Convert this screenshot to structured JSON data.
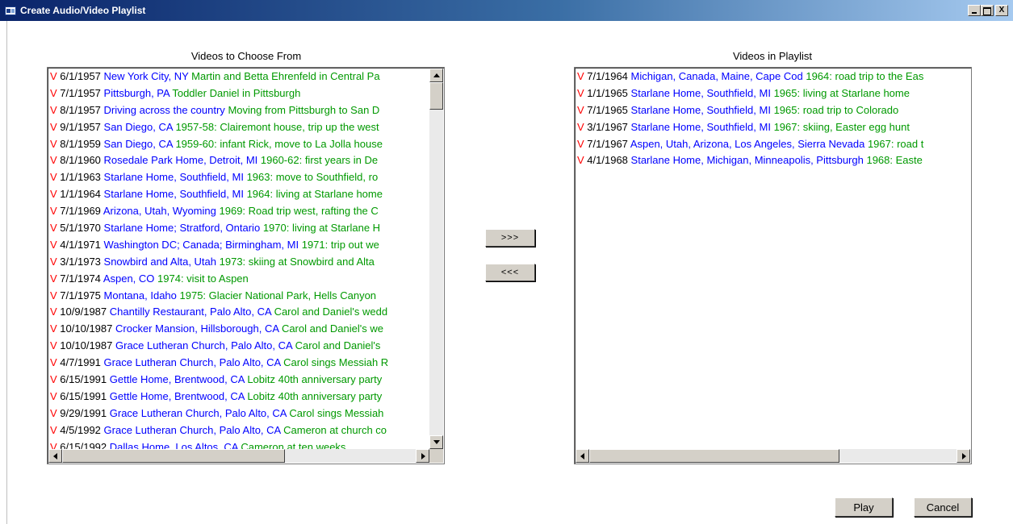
{
  "window": {
    "title": "Create Audio/Video Playlist",
    "buttons": {
      "minimize": "_",
      "maximize": "□",
      "close": "X"
    }
  },
  "available": {
    "label": "Videos to Choose From",
    "items": [
      {
        "type": "V",
        "date": "6/1/1957",
        "place": "New York City, NY",
        "desc": "Martin and Betta Ehrenfeld in Central Pa"
      },
      {
        "type": "V",
        "date": "7/1/1957",
        "place": "Pittsburgh, PA",
        "desc": "Toddler Daniel in Pittsburgh"
      },
      {
        "type": "V",
        "date": "8/1/1957",
        "place": "Driving across the country",
        "desc": "Moving from Pittsburgh to San D"
      },
      {
        "type": "V",
        "date": "9/1/1957",
        "place": "San Diego, CA",
        "desc": "1957-58: Clairemont house, trip up the west"
      },
      {
        "type": "V",
        "date": "8/1/1959",
        "place": "San Diego, CA",
        "desc": "1959-60: infant Rick, move to La Jolla house"
      },
      {
        "type": "V",
        "date": "8/1/1960",
        "place": "Rosedale Park Home, Detroit, MI",
        "desc": "1960-62: first years in De"
      },
      {
        "type": "V",
        "date": "1/1/1963",
        "place": "Starlane Home, Southfield, MI",
        "desc": "1963: move to Southfield, ro"
      },
      {
        "type": "V",
        "date": "1/1/1964",
        "place": "Starlane Home, Southfield, MI",
        "desc": "1964: living at Starlane home"
      },
      {
        "type": "V",
        "date": "7/1/1969",
        "place": "Arizona, Utah, Wyoming",
        "desc": "1969: Road trip west, rafting the C"
      },
      {
        "type": "V",
        "date": "5/1/1970",
        "place": "Starlane Home; Stratford, Ontario",
        "desc": "1970: living at Starlane H"
      },
      {
        "type": "V",
        "date": "4/1/1971",
        "place": "Washington DC; Canada; Birmingham, MI",
        "desc": "1971: trip out we"
      },
      {
        "type": "V",
        "date": "3/1/1973",
        "place": "Snowbird and Alta, Utah",
        "desc": "1973: skiing at Snowbird and Alta"
      },
      {
        "type": "V",
        "date": "7/1/1974",
        "place": "Aspen, CO",
        "desc": "1974: visit to Aspen"
      },
      {
        "type": "V",
        "date": "7/1/1975",
        "place": "Montana, Idaho",
        "desc": "1975: Glacier National Park, Hells Canyon"
      },
      {
        "type": "V",
        "date": "10/9/1987",
        "place": "Chantilly Restaurant, Palo Alto, CA",
        "desc": "Carol and Daniel's wedd"
      },
      {
        "type": "V",
        "date": "10/10/1987",
        "place": "Crocker Mansion, Hillsborough, CA",
        "desc": "Carol and Daniel's we"
      },
      {
        "type": "V",
        "date": "10/10/1987",
        "place": "Grace Lutheran Church, Palo Alto, CA",
        "desc": "Carol and Daniel's"
      },
      {
        "type": "V",
        "date": "4/7/1991",
        "place": "Grace Lutheran Church, Palo Alto, CA",
        "desc": "Carol sings Messiah R"
      },
      {
        "type": "V",
        "date": "6/15/1991",
        "place": "Gettle Home, Brentwood, CA",
        "desc": "Lobitz 40th anniversary party"
      },
      {
        "type": "V",
        "date": "6/15/1991",
        "place": "Gettle Home, Brentwood, CA",
        "desc": "Lobitz 40th anniversary party"
      },
      {
        "type": "V",
        "date": "9/29/1991",
        "place": "Grace Lutheran Church, Palo Alto, CA",
        "desc": "Carol sings Messiah"
      },
      {
        "type": "V",
        "date": "4/5/1992",
        "place": "Grace Lutheran Church, Palo Alto, CA",
        "desc": "Cameron at church co"
      },
      {
        "type": "V",
        "date": "6/15/1992",
        "place": "Dallas Home, Los Altos, CA",
        "desc": "Cameron at ten weeks"
      }
    ]
  },
  "playlist": {
    "label": "Videos in Playlist",
    "items": [
      {
        "type": "V",
        "date": "7/1/1964",
        "place": "Michigan, Canada, Maine, Cape Cod",
        "desc": "1964: road trip to the Eas"
      },
      {
        "type": "V",
        "date": "1/1/1965",
        "place": "Starlane Home, Southfield, MI",
        "desc": "1965: living at Starlane home"
      },
      {
        "type": "V",
        "date": "7/1/1965",
        "place": "Starlane Home, Southfield, MI",
        "desc": "1965: road trip to Colorado"
      },
      {
        "type": "V",
        "date": "3/1/1967",
        "place": "Starlane Home, Southfield, MI",
        "desc": "1967: skiing, Easter egg hunt"
      },
      {
        "type": "V",
        "date": "7/1/1967",
        "place": "Aspen, Utah, Arizona, Los Angeles, Sierra Nevada",
        "desc": "1967: road t"
      },
      {
        "type": "V",
        "date": "4/1/1968",
        "place": "Starlane Home, Michigan, Minneapolis, Pittsburgh",
        "desc": "1968: Easte"
      }
    ]
  },
  "actions": {
    "add": ">>>",
    "remove": "<<<",
    "play": "Play",
    "cancel": "Cancel"
  },
  "colors": {
    "type": "#ff0000",
    "date": "#000000",
    "place": "#0000ff",
    "desc": "#009900"
  }
}
